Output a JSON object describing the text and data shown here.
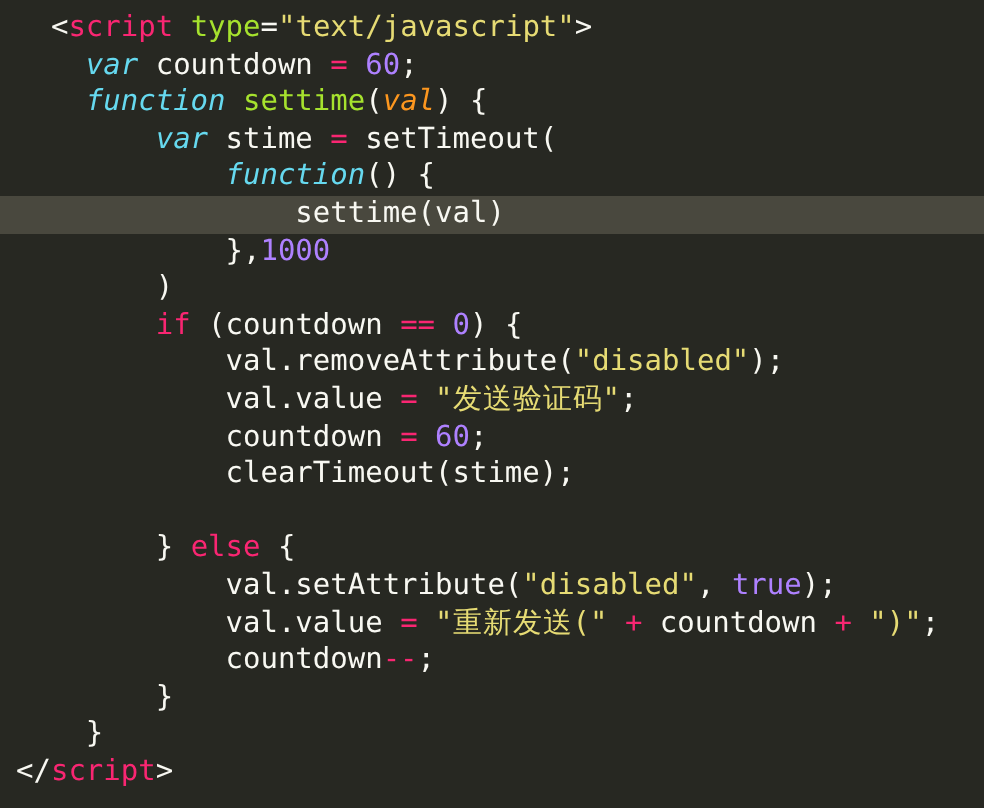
{
  "lines": [
    {
      "selected": false,
      "tokens": [
        {
          "kind": "plain",
          "text": "  <"
        },
        {
          "kind": "tag",
          "text": "script"
        },
        {
          "kind": "attr",
          "text": " type"
        },
        {
          "kind": "plain",
          "text": "="
        },
        {
          "kind": "string",
          "text": "\"text/javascript\""
        },
        {
          "kind": "plain",
          "text": ">"
        }
      ]
    },
    {
      "selected": false,
      "tokens": [
        {
          "kind": "keyword",
          "text": "    var"
        },
        {
          "kind": "plain",
          "text": " countdown "
        },
        {
          "kind": "operator",
          "text": "="
        },
        {
          "kind": "number",
          "text": " 60"
        },
        {
          "kind": "plain",
          "text": ";"
        }
      ]
    },
    {
      "selected": false,
      "tokens": [
        {
          "kind": "keyword",
          "text": "    function"
        },
        {
          "kind": "name",
          "text": " settime"
        },
        {
          "kind": "plain",
          "text": "("
        },
        {
          "kind": "param",
          "text": "val"
        },
        {
          "kind": "plain",
          "text": ") {"
        }
      ]
    },
    {
      "selected": false,
      "tokens": [
        {
          "kind": "keyword",
          "text": "        var"
        },
        {
          "kind": "plain",
          "text": " stime "
        },
        {
          "kind": "operator",
          "text": "="
        },
        {
          "kind": "plain",
          "text": " setTimeout("
        }
      ]
    },
    {
      "selected": false,
      "tokens": [
        {
          "kind": "keyword",
          "text": "            function"
        },
        {
          "kind": "plain",
          "text": "() {"
        }
      ]
    },
    {
      "selected": true,
      "tokens": [
        {
          "kind": "plain",
          "text": "                settime(val)"
        }
      ]
    },
    {
      "selected": false,
      "tokens": [
        {
          "kind": "plain",
          "text": "            },"
        },
        {
          "kind": "number",
          "text": "1000"
        }
      ]
    },
    {
      "selected": false,
      "tokens": [
        {
          "kind": "plain",
          "text": "        )"
        }
      ]
    },
    {
      "selected": false,
      "tokens": [
        {
          "kind": "tag",
          "text": "        if"
        },
        {
          "kind": "plain",
          "text": " (countdown "
        },
        {
          "kind": "operator",
          "text": "=="
        },
        {
          "kind": "number",
          "text": " 0"
        },
        {
          "kind": "plain",
          "text": ") {"
        }
      ]
    },
    {
      "selected": false,
      "tokens": [
        {
          "kind": "plain",
          "text": "            val.removeAttribute("
        },
        {
          "kind": "string",
          "text": "\"disabled\""
        },
        {
          "kind": "plain",
          "text": ");"
        }
      ]
    },
    {
      "selected": false,
      "tokens": [
        {
          "kind": "plain",
          "text": "            val.value "
        },
        {
          "kind": "operator",
          "text": "="
        },
        {
          "kind": "string",
          "text": " \"发送验证码\""
        },
        {
          "kind": "plain",
          "text": ";"
        }
      ]
    },
    {
      "selected": false,
      "tokens": [
        {
          "kind": "plain",
          "text": "            countdown "
        },
        {
          "kind": "operator",
          "text": "="
        },
        {
          "kind": "number",
          "text": " 60"
        },
        {
          "kind": "plain",
          "text": ";"
        }
      ]
    },
    {
      "selected": false,
      "tokens": [
        {
          "kind": "plain",
          "text": "            clearTimeout(stime);"
        }
      ]
    },
    {
      "selected": false
    },
    {
      "selected": false,
      "tokens": [
        {
          "kind": "plain",
          "text": "        } "
        },
        {
          "kind": "tag",
          "text": "else"
        },
        {
          "kind": "plain",
          "text": " {"
        }
      ]
    },
    {
      "selected": false,
      "tokens": [
        {
          "kind": "plain",
          "text": "            val.setAttribute("
        },
        {
          "kind": "string",
          "text": "\"disabled\""
        },
        {
          "kind": "plain",
          "text": ", "
        },
        {
          "kind": "number",
          "text": "true"
        },
        {
          "kind": "plain",
          "text": ");"
        }
      ]
    },
    {
      "selected": false,
      "tokens": [
        {
          "kind": "plain",
          "text": "            val.value "
        },
        {
          "kind": "operator",
          "text": "="
        },
        {
          "kind": "string",
          "text": " \"重新发送(\""
        },
        {
          "kind": "operator",
          "text": " +"
        },
        {
          "kind": "plain",
          "text": " countdown "
        },
        {
          "kind": "operator",
          "text": "+"
        },
        {
          "kind": "string",
          "text": " \")\""
        },
        {
          "kind": "plain",
          "text": ";"
        }
      ]
    },
    {
      "selected": false,
      "tokens": [
        {
          "kind": "plain",
          "text": "            countdown"
        },
        {
          "kind": "operator",
          "text": "--"
        },
        {
          "kind": "plain",
          "text": ";"
        }
      ]
    },
    {
      "selected": false,
      "tokens": [
        {
          "kind": "plain",
          "text": "        }"
        }
      ]
    },
    {
      "selected": false,
      "tokens": [
        {
          "kind": "plain",
          "text": "    }"
        }
      ]
    },
    {
      "selected": false,
      "tokens": [
        {
          "kind": "plain",
          "text": "</"
        },
        {
          "kind": "tag",
          "text": "script"
        },
        {
          "kind": "plain",
          "text": ">"
        }
      ]
    }
  ]
}
